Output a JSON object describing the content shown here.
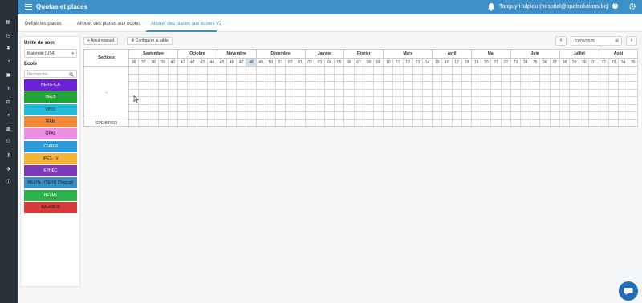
{
  "app": {
    "title": "Quotas et places",
    "user": "Tanguy Hulpiau (hospital@opalsolutions.be)",
    "help_label": "?"
  },
  "rail_icons": [
    "calendar-icon",
    "clock-icon",
    "hourglass-icon",
    "gauge-icon",
    "bus-icon",
    "stethoscope-icon",
    "dumbbell-icon",
    "pie-chart-icon",
    "file-icon",
    "users-icon",
    "keys-icon",
    "tag-icon",
    "info-icon"
  ],
  "tabs": [
    {
      "label": "Définir les places"
    },
    {
      "label": "Allouer des places aux écoles"
    },
    {
      "label": "Allouer des places aux écoles V2"
    }
  ],
  "left": {
    "unit_label": "Unité de soin",
    "unit_value": "Maternité [US4]",
    "school_label": "Ecole",
    "search_placeholder": "Rechercher",
    "schools": [
      {
        "name": "HERS-ICA",
        "bg": "#6b1fd6",
        "fg": "#ffffff"
      },
      {
        "name": "HELB",
        "bg": "#1fa336",
        "fg": "#ffffff"
      },
      {
        "name": "VINCI",
        "bg": "#22bcd8",
        "fg": "#1b1b1b"
      },
      {
        "name": "IFAM",
        "bg": "#f08a3a",
        "fg": "#1b1b1b"
      },
      {
        "name": "OPAL",
        "bg": "#ee8fe6",
        "fg": "#1b1b1b"
      },
      {
        "name": "CFARM",
        "bg": "#2c9ad6",
        "fg": "#ffffff"
      },
      {
        "name": "IPES - V",
        "bg": "#f5b43a",
        "fg": "#1b1b1b"
      },
      {
        "name": "EPHEC",
        "bg": "#7b3ab8",
        "fg": "#ffffff"
      },
      {
        "name": "HELHa - ITEHO (Tournai)",
        "bg": "#3c8fc6",
        "fg": "#1b1b1b"
      },
      {
        "name": "HELMo",
        "bg": "#2bb04a",
        "fg": "#ffffff"
      },
      {
        "name": "BA+HBO5",
        "bg": "#d63a3a",
        "fg": "#1b1b1b"
      }
    ]
  },
  "toolbar": {
    "add_label": "Ajout manuel",
    "config_label": "Configurer la table",
    "date_value": "01/09/2025",
    "prev": "‹",
    "next": "›"
  },
  "table": {
    "sections_header": "Sections",
    "row_dot": "-",
    "row_spe": "SPE BIRSO",
    "current_week": "48",
    "months": [
      {
        "name": "Septembre",
        "weeks": 5
      },
      {
        "name": "Octobre",
        "weeks": 4
      },
      {
        "name": "Novembre",
        "weeks": 4
      },
      {
        "name": "Décembre",
        "weeks": 5
      },
      {
        "name": "Janvier",
        "weeks": 4
      },
      {
        "name": "Février",
        "weeks": 4
      },
      {
        "name": "Mars",
        "weeks": 5
      },
      {
        "name": "Avril",
        "weeks": 4
      },
      {
        "name": "Mai",
        "weeks": 4
      },
      {
        "name": "Juin",
        "weeks": 5
      },
      {
        "name": "Juillet",
        "weeks": 4
      },
      {
        "name": "Août",
        "weeks": 4
      }
    ],
    "weeks": [
      "36",
      "37",
      "38",
      "39",
      "40",
      "41",
      "42",
      "43",
      "44",
      "45",
      "46",
      "47",
      "48",
      "49",
      "50",
      "51",
      "52",
      "01",
      "02",
      "03",
      "04",
      "05",
      "06",
      "07",
      "08",
      "09",
      "10",
      "11",
      "12",
      "13",
      "14",
      "15",
      "16",
      "17",
      "18",
      "19",
      "20",
      "21",
      "22",
      "23",
      "24",
      "25",
      "26",
      "27",
      "28",
      "29",
      "30",
      "31",
      "32",
      "33",
      "34",
      "35"
    ]
  }
}
